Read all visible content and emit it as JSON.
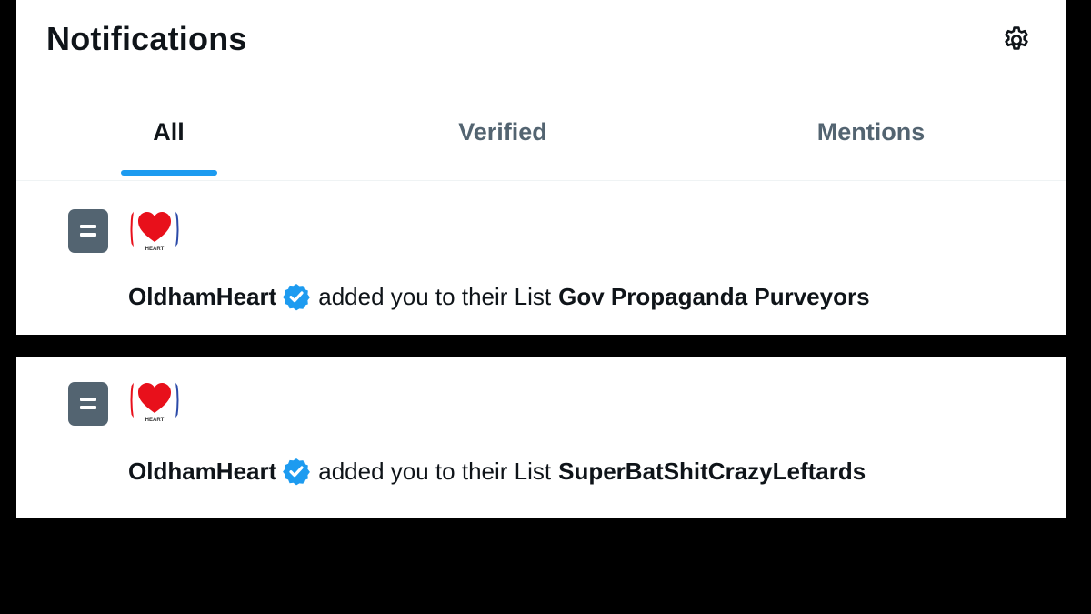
{
  "header": {
    "title": "Notifications",
    "settings_icon": "gear-icon"
  },
  "tabs": [
    {
      "label": "All",
      "active": true
    },
    {
      "label": "Verified",
      "active": false
    },
    {
      "label": "Mentions",
      "active": false
    }
  ],
  "colors": {
    "accent": "#1d9bf0",
    "text_primary": "#0f1419",
    "text_secondary": "#536471",
    "heart": "#e8101b"
  },
  "notifications": [
    {
      "icon": "list-icon",
      "avatar_text": "HEART",
      "user": "OldhamHeart",
      "verified": true,
      "action": "added you to their List",
      "list_name": "Gov Propaganda Purveyors"
    },
    {
      "icon": "list-icon",
      "avatar_text": "HEART",
      "user": "OldhamHeart",
      "verified": true,
      "action": "added you to their List",
      "list_name": "SuperBatShitCrazyLeftards"
    }
  ]
}
